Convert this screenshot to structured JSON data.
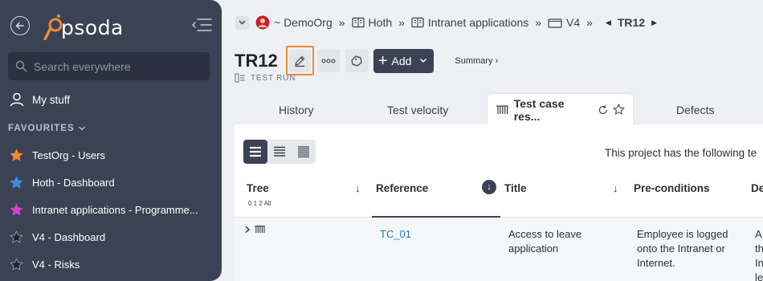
{
  "sidebar": {
    "logo_text": "psoda",
    "search_placeholder": "Search everywhere",
    "my_stuff": "My stuff",
    "favourites_header": "FAVOURITES",
    "favourites": [
      {
        "label": "TestOrg - Users",
        "color": "#f08a32"
      },
      {
        "label": "Hoth - Dashboard",
        "color": "#3d8ee0"
      },
      {
        "label": "Intranet applications - Programme...",
        "color": "#d63fd0"
      },
      {
        "label": "V4 - Dashboard",
        "color": "#1f232a"
      },
      {
        "label": "V4 - Risks",
        "color": "#1f232a"
      }
    ]
  },
  "breadcrumb": {
    "org": "~ DemoOrg",
    "items": [
      "Hoth",
      "Intranet applications",
      "V4"
    ],
    "current": "TR12",
    "separator": "»"
  },
  "header": {
    "title": "TR12",
    "add_label": "Add",
    "summary_label": "Summary ›",
    "subtitle": "TEST RUN"
  },
  "tabs": {
    "history": "History",
    "velocity": "Test velocity",
    "active": "Test case res...",
    "defects": "Defects"
  },
  "panel": {
    "project_text": "This project has the following te",
    "columns": {
      "tree": "Tree",
      "levels": "0 1 2 All",
      "reference": "Reference",
      "title": "Title",
      "preconditions": "Pre-conditions",
      "description": "De"
    },
    "row": {
      "reference": "TC_01",
      "title_line1": "Access to leave",
      "title_line2": "application",
      "pre_line1": "Employee is logged",
      "pre_line2": "onto the Intranet or",
      "pre_line3": "Internet.",
      "desc_line1": "A",
      "desc_line2": "th",
      "desc_line3": "In",
      "desc_line4": "le"
    }
  },
  "colors": {
    "sidebar_bg": "#3b4253",
    "accent_orange": "#f08a32",
    "link_blue": "#1f7ac4",
    "dark_button": "#3b4253"
  }
}
